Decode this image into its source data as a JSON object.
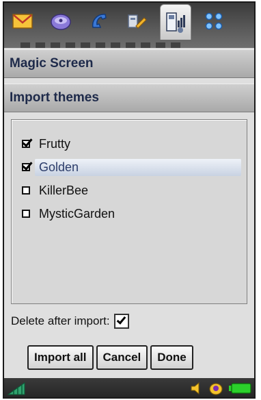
{
  "icons": [
    "mail-icon",
    "disc-icon",
    "phone-icon",
    "tools-icon",
    "settings-display-icon",
    "apps-grid-icon"
  ],
  "active_tab_index": 4,
  "title": "Magic Screen",
  "section": "Import themes",
  "themes": [
    {
      "name": "Frutty",
      "checked": true,
      "selected": false
    },
    {
      "name": "Golden",
      "checked": true,
      "selected": true
    },
    {
      "name": "KillerBee",
      "checked": false,
      "selected": false
    },
    {
      "name": "MysticGarden",
      "checked": false,
      "selected": false
    }
  ],
  "delete_after_import": {
    "label": "Delete after import:",
    "checked": true
  },
  "buttons": {
    "import_all": "Import all",
    "cancel": "Cancel",
    "done": "Done"
  },
  "colors": {
    "accent_text": "#1e2a4a",
    "selection": "#c8d2e2",
    "battery": "#2bd12b",
    "signal": "#31a26e"
  }
}
